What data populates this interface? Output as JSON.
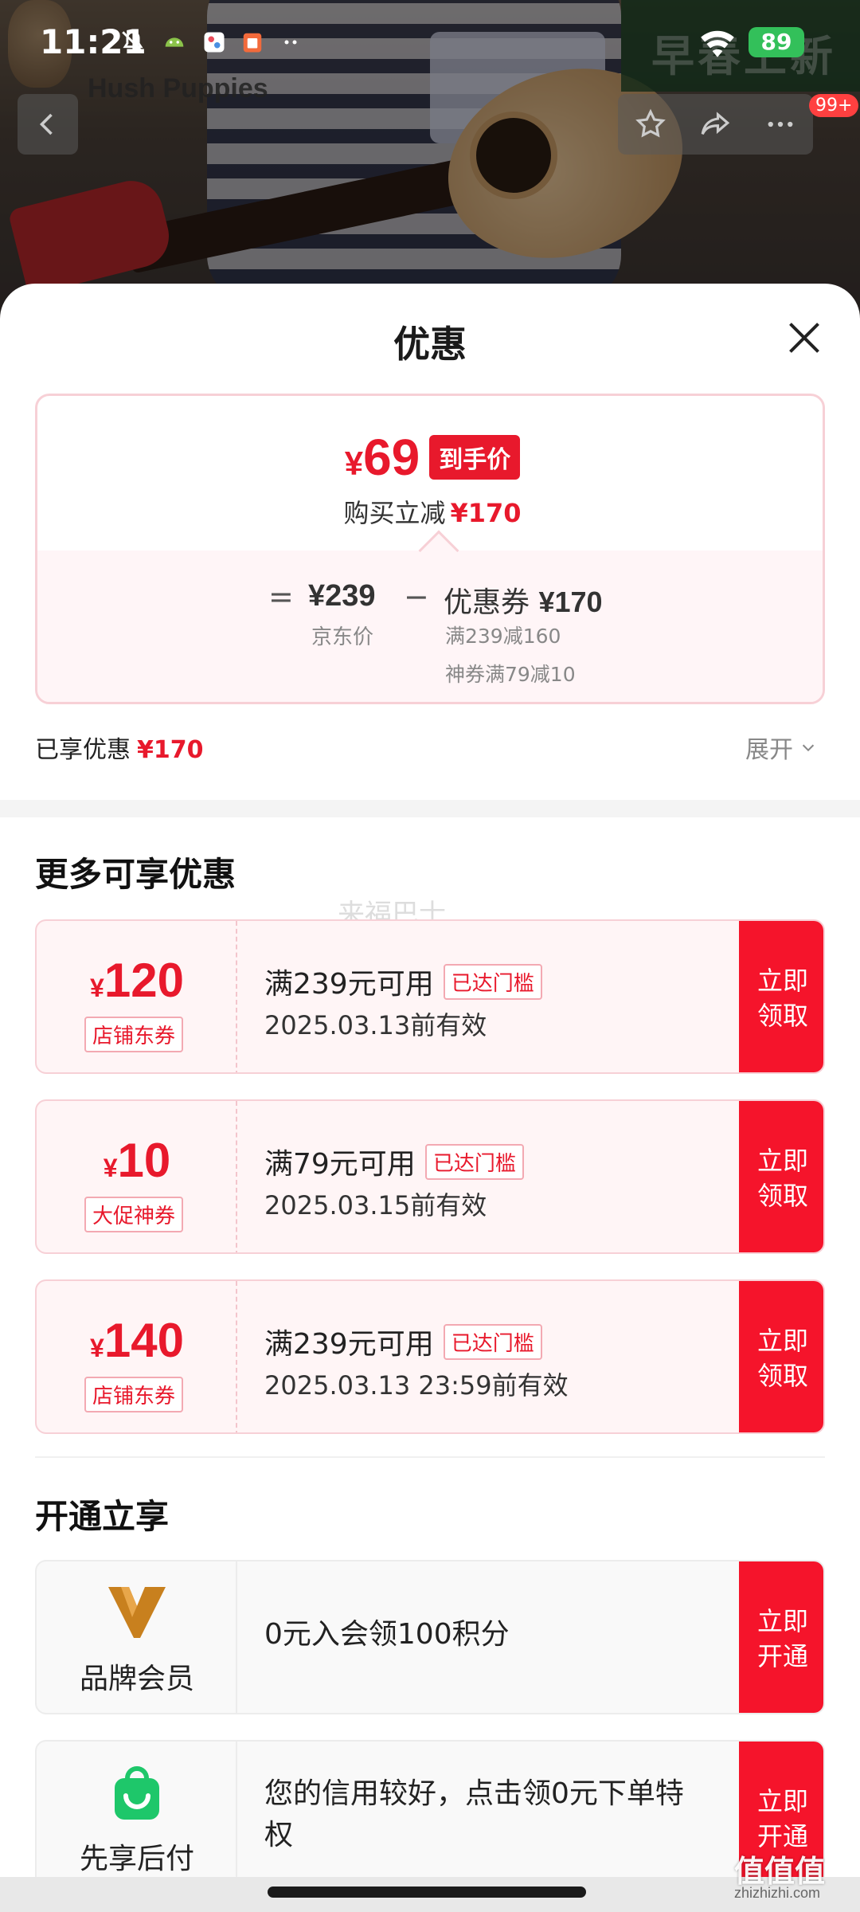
{
  "status_bar": {
    "time": "11:21",
    "battery": "89",
    "icons": [
      "mute-icon",
      "android-icon",
      "photos-icon",
      "clipboard-icon",
      "more-dots-icon",
      "wifi-icon",
      "battery-icon"
    ]
  },
  "background": {
    "brand_text": "Hush Puppies",
    "corner_overlay_text": "早春上新",
    "notification_count": "99+"
  },
  "sheet": {
    "title": "优惠",
    "summary": {
      "final_price_symbol": "¥",
      "final_price": "69",
      "final_price_tag": "到手价",
      "reduce_label": "购买立减",
      "reduce_amount": "¥170",
      "equals": "=",
      "jd_price": "¥239",
      "jd_price_label": "京东价",
      "minus": "−",
      "coupon_label": "优惠券",
      "coupon_total": "¥170",
      "coupon_detail_1": "满239减160",
      "coupon_detail_2": "神券满79减10"
    },
    "enjoyed_label": "已享优惠",
    "enjoyed_amount": "¥170",
    "expand_label": "展开",
    "more_section_title": "更多可享优惠",
    "watermark": "来福巴士",
    "coupons": [
      {
        "symbol": "¥",
        "amount": "120",
        "type": "店铺东券",
        "condition": "满239元可用",
        "tag": "已达门槛",
        "date": "2025.03.13前有效",
        "button": "立即领取"
      },
      {
        "symbol": "¥",
        "amount": "10",
        "type": "大促神券",
        "condition": "满79元可用",
        "tag": "已达门槛",
        "date": "2025.03.15前有效",
        "button": "立即领取"
      },
      {
        "symbol": "¥",
        "amount": "140",
        "type": "店铺东券",
        "condition": "满239元可用",
        "tag": "已达门槛",
        "date": "2025.03.13 23:59前有效",
        "button": "立即领取"
      }
    ],
    "open_section_title": "开通立享",
    "members": [
      {
        "label": "品牌会员",
        "icon": "brand-v-icon",
        "text": "0元入会领100积分",
        "button": "立即开通"
      },
      {
        "label": "先享后付",
        "icon": "shopping-bag-icon",
        "text": "您的信用较好，点击领0元下单特权",
        "button": "立即开通"
      }
    ]
  },
  "site_mark": "值值值",
  "site_url": "zhizhizhi.com",
  "colors": {
    "accent": "#e8192c",
    "button_red": "#f5142b",
    "card_pink": "#fff5f6",
    "member_green": "#1ec76a",
    "member_gold": "#c8801e"
  }
}
